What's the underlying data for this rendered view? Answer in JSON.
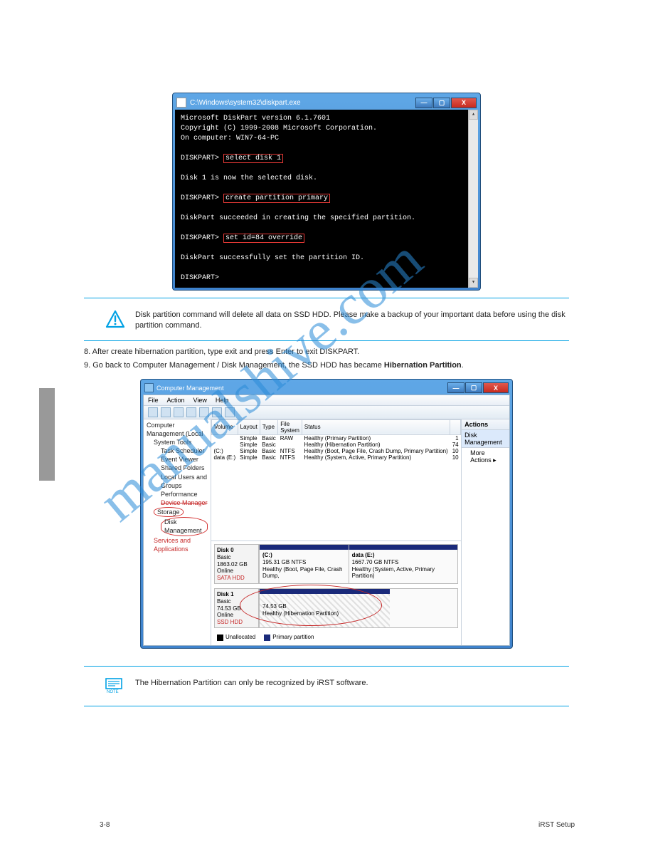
{
  "watermark": "manualshive.com",
  "section_title": "iRST Setup",
  "page_number": "3-8",
  "console": {
    "title": "C:\\Windows\\system32\\diskpart.exe",
    "lines": {
      "l1": "Microsoft DiskPart version 6.1.7601",
      "l2": "Copyright (C) 1999-2008 Microsoft Corporation.",
      "l3": "On computer: WIN7-64-PC",
      "prompt": "DISKPART> ",
      "cmd1": "select disk 1",
      "resp1": "Disk 1 is now the selected disk.",
      "cmd2": "create partition primary",
      "resp2": "DiskPart succeeded in creating the specified partition.",
      "cmd3": "set id=84 override",
      "resp3": "DiskPart successfully set the partition ID."
    },
    "winbtns": {
      "min": "—",
      "max": "▢",
      "close": "X"
    }
  },
  "caution": {
    "text": "Disk partition command will delete all data on SSD HDD. Please make a backup of your important data before using the disk partition command."
  },
  "step8": "8. After create hibernation partition, type exit and press Enter to exit DISKPART.",
  "step9_a": "9. Go back to Computer Management / Disk Management, the SSD HDD has became ",
  "step9_b": "Hibernation Partition",
  "step9_c": ".",
  "note": "The Hibernation Partition can only be recognized by iRST software.",
  "cm": {
    "title": "Computer Management",
    "menus": [
      "File",
      "Action",
      "View",
      "Help"
    ],
    "tree": {
      "root": "Computer Management (Local",
      "sys_tools": "System Tools",
      "items": [
        "Task Scheduler",
        "Event Viewer",
        "Shared Folders",
        "Local Users and Groups",
        "Performance",
        "Device Manager"
      ],
      "storage": "Storage",
      "disk_mgmt": "Disk Management",
      "svc": "Services and Applications"
    },
    "voltable": {
      "headers": [
        "Volume",
        "Layout",
        "Type",
        "File System",
        "Status"
      ],
      "rows": [
        {
          "v": "",
          "l": "Simple",
          "t": "Basic",
          "fs": "RAW",
          "s": "Healthy (Primary Partition)",
          "c": "1"
        },
        {
          "v": "",
          "l": "Simple",
          "t": "Basic",
          "fs": "",
          "s": "Healthy (Hibernation Partition)",
          "c": "74"
        },
        {
          "v": "(C:)",
          "l": "Simple",
          "t": "Basic",
          "fs": "NTFS",
          "s": "Healthy (Boot, Page File, Crash Dump, Primary Partition)",
          "c": "10"
        },
        {
          "v": "data (E:)",
          "l": "Simple",
          "t": "Basic",
          "fs": "NTFS",
          "s": "Healthy (System, Active, Primary Partition)",
          "c": "10"
        }
      ]
    },
    "actions": {
      "hd": "Actions",
      "dm": "Disk Management",
      "more": "More Actions"
    },
    "disks": {
      "d0": {
        "name": "Disk 0",
        "type": "Basic",
        "size": "1863.02 GB",
        "stat": "Online",
        "p1": {
          "label": "(C:)",
          "line2": "195.31 GB NTFS",
          "line3": "Healthy (Boot, Page File, Crash Dump,"
        },
        "p2": {
          "label": "data  (E:)",
          "line2": "1667.70 GB NTFS",
          "line3": "Healthy (System, Active, Primary Partition)"
        },
        "tag": "SATA HDD"
      },
      "d1": {
        "name": "Disk 1",
        "type": "Basic",
        "size": "74.53 GB",
        "stat": "Online",
        "p1": {
          "label": "",
          "line2": "74.53 GB",
          "line3": "Healthy (Hibernation Partition)"
        },
        "tag": "SSD HDD"
      }
    },
    "legend": {
      "u": "Unallocated",
      "p": "Primary partition"
    }
  }
}
